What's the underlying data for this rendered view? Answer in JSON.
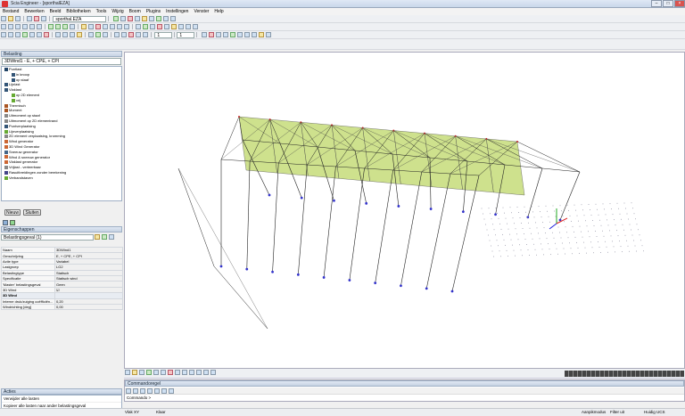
{
  "window": {
    "title": "Scia Engineer - [sporthalEZA]"
  },
  "menu": [
    "Bestand",
    "Bewerken",
    "Beeld",
    "Bibliotheken",
    "Tools",
    "Wijzig",
    "Boom",
    "Plugins",
    "Instellingen",
    "Venster",
    "Help"
  ],
  "toolbar": {
    "project_combo": "sporthal.EZA",
    "spin1": "1",
    "spin2": "1"
  },
  "left": {
    "panel_title": "Belasting",
    "loadcase": "3DWind1 - E, + CPE, + CPI",
    "tree": [
      "Puntlast",
      "in knoop",
      "op staaf",
      "Lijnlast",
      "Vlaklast",
      "op 2D element",
      "vrij",
      "Thermisch",
      "Moment",
      "Uitmoment op staaf",
      "Uitmoment op 2D elementrand",
      "Puntverplaatsing",
      "Lijnverplaatsing",
      "2D element verplaatsing, kromming",
      "Wind generator",
      "3D Wind Generator",
      "Sneeuw generator",
      "Wind & sneeuw generator",
      "Vlaklast generator",
      "Vrijlast - verteerbaar",
      "Rasuitbreidingen zonder berekening",
      "Verbandstaven"
    ],
    "buttons": {
      "new": "Nieuw",
      "close": "Sluiten"
    },
    "props_title": "Eigenschappen",
    "props_combo": "Belastingsgeval (1)",
    "props": [
      {
        "k": "Naam",
        "v": "3DWind1"
      },
      {
        "k": "Omschrijving",
        "v": "E, + CPE, + CPI"
      },
      {
        "k": "Actie type",
        "v": "Variabel"
      },
      {
        "k": "Lastgroep",
        "v": "LG2"
      },
      {
        "k": "Belastingtype",
        "v": "Statisch"
      },
      {
        "k": "Specificatie",
        "v": "Statisch wind"
      },
      {
        "k": "'Master' belastingsgeval",
        "v": "Geen"
      },
      {
        "k": "3D Wind",
        "v": "☑"
      }
    ],
    "props_section": "3D Wind",
    "props2": [
      {
        "k": "Interne druk/zuiging coëfficiën...",
        "v": "0,20"
      },
      {
        "k": "Windrichting [deg]",
        "v": "0,00"
      }
    ],
    "actions_title": "Acties",
    "actions": [
      "Verwijder alle lasten",
      "Kopieer alle lasten naar ander belastingsgeval"
    ]
  },
  "cmd": {
    "title": "Commandoregel",
    "prompt": "Commando >"
  },
  "status": {
    "left1": "Vlak XY",
    "left2": "Klaar",
    "r1": "Aanpikmodus",
    "r2": "Filter uit",
    "r3": "Huidig UCS"
  }
}
